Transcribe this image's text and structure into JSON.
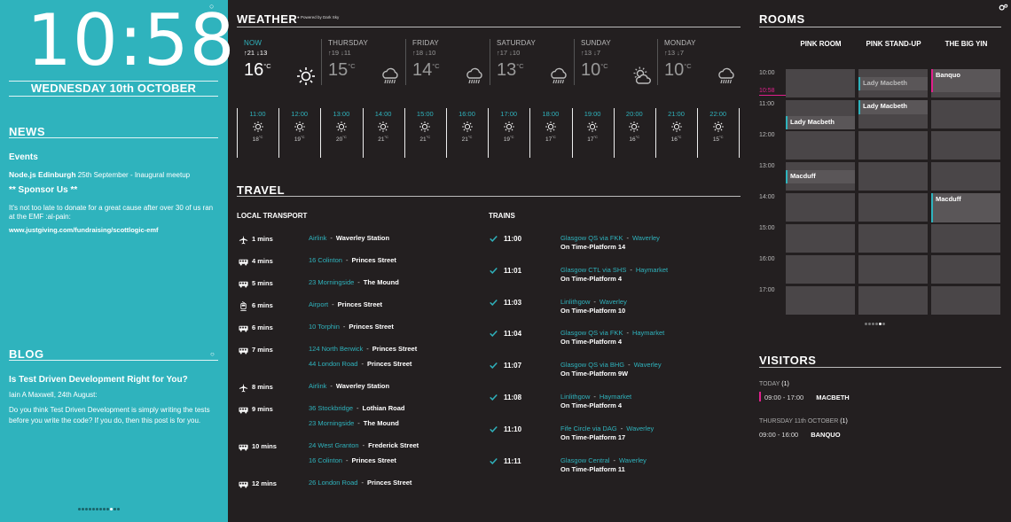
{
  "clock": {
    "time": "10:58",
    "date": "WEDNESDAY 10th OCTOBER"
  },
  "news": {
    "heading": "NEWS",
    "events_label": "Events",
    "event_name": "Node.js Edinburgh",
    "event_detail": "25th September - Inaugural meetup",
    "sponsor": "** Sponsor Us **",
    "body": "It's not too late to donate for a great cause after over 30 of us ran at the EMF :al-pain:",
    "link": "www.justgiving.com/fundraising/scottlogic-emf"
  },
  "blog": {
    "heading": "BLOG",
    "title": "Is Test Driven Development Right for You?",
    "author": "Iain A Maxwell, 24th August:",
    "body": "Do you think Test Driven Development is simply writing the tests before you write the code? If you do, then this post is for you."
  },
  "left_pager": {
    "count": 12,
    "active": 9
  },
  "weather": {
    "heading": "WEATHER",
    "powered": "Powered by Dark Sky",
    "days": [
      {
        "name": "NOW",
        "hilo": "↑21 ↓13",
        "temp": "16",
        "unit": "°C",
        "icon": "sun-icon"
      },
      {
        "name": "THURSDAY",
        "hilo": "↑19 ↓11",
        "temp": "15",
        "unit": "°C",
        "icon": "rain-icon"
      },
      {
        "name": "FRIDAY",
        "hilo": "↑18 ↓10",
        "temp": "14",
        "unit": "°C",
        "icon": "rain-icon"
      },
      {
        "name": "SATURDAY",
        "hilo": "↑17 ↓10",
        "temp": "13",
        "unit": "°C",
        "icon": "rain-icon"
      },
      {
        "name": "SUNDAY",
        "hilo": "↑13 ↓7",
        "temp": "10",
        "unit": "°C",
        "icon": "partly-cloudy-icon"
      },
      {
        "name": "MONDAY",
        "hilo": "↑13 ↓7",
        "temp": "10",
        "unit": "°C",
        "icon": "rain-icon"
      }
    ],
    "hours": [
      {
        "time": "11:00",
        "temp": "18",
        "unit": "°C"
      },
      {
        "time": "12:00",
        "temp": "19",
        "unit": "°C"
      },
      {
        "time": "13:00",
        "temp": "20",
        "unit": "°C"
      },
      {
        "time": "14:00",
        "temp": "21",
        "unit": "°C"
      },
      {
        "time": "15:00",
        "temp": "21",
        "unit": "°C"
      },
      {
        "time": "16:00",
        "temp": "21",
        "unit": "°C"
      },
      {
        "time": "17:00",
        "temp": "19",
        "unit": "°C"
      },
      {
        "time": "18:00",
        "temp": "17",
        "unit": "°C"
      },
      {
        "time": "19:00",
        "temp": "17",
        "unit": "°C"
      },
      {
        "time": "20:00",
        "temp": "16",
        "unit": "°C"
      },
      {
        "time": "21:00",
        "temp": "16",
        "unit": "°C"
      },
      {
        "time": "22:00",
        "temp": "15",
        "unit": "°C"
      }
    ]
  },
  "travel": {
    "heading": "TRAVEL",
    "local_heading": "LOCAL TRANSPORT",
    "trains_heading": "TRAINS",
    "local": [
      {
        "icon": "plane-icon",
        "mins": "1 mins",
        "lines": [
          {
            "route": "Airlink",
            "dest": "Waverley Station"
          }
        ]
      },
      {
        "icon": "bus-icon",
        "mins": "4 mins",
        "lines": [
          {
            "route": "16 Colinton",
            "dest": "Princes Street"
          }
        ]
      },
      {
        "icon": "bus-icon",
        "mins": "5 mins",
        "lines": [
          {
            "route": "23 Morningside",
            "dest": "The Mound"
          }
        ]
      },
      {
        "icon": "tram-icon",
        "mins": "6 mins",
        "lines": [
          {
            "route": "Airport",
            "dest": "Princes Street"
          }
        ]
      },
      {
        "icon": "bus-icon",
        "mins": "6 mins",
        "lines": [
          {
            "route": "10 Torphin",
            "dest": "Princes Street"
          }
        ]
      },
      {
        "icon": "bus-icon",
        "mins": "7 mins",
        "lines": [
          {
            "route": "124 North Berwick",
            "dest": "Princes Street"
          },
          {
            "route": "44 London Road",
            "dest": "Princes Street"
          }
        ]
      },
      {
        "icon": "plane-icon",
        "mins": "8 mins",
        "lines": [
          {
            "route": "Airlink",
            "dest": "Waverley Station"
          }
        ]
      },
      {
        "icon": "bus-icon",
        "mins": "9 mins",
        "lines": [
          {
            "route": "36 Stockbridge",
            "dest": "Lothian Road"
          },
          {
            "route": "23 Morningside",
            "dest": "The Mound"
          }
        ]
      },
      {
        "icon": "bus-icon",
        "mins": "10 mins",
        "lines": [
          {
            "route": "24 West Granton",
            "dest": "Frederick Street"
          },
          {
            "route": "16 Colinton",
            "dest": "Princes Street"
          }
        ]
      },
      {
        "icon": "bus-icon",
        "mins": "12 mins",
        "lines": [
          {
            "route": "26 London Road",
            "dest": "Princes Street"
          }
        ]
      }
    ],
    "trains": [
      {
        "time": "11:00",
        "from": "Glasgow QS via FKK",
        "to": "Waverley",
        "status": "On Time",
        "platform": "Platform 14"
      },
      {
        "time": "11:01",
        "from": "Glasgow CTL via SHS",
        "to": "Haymarket",
        "status": "On Time",
        "platform": "Platform 4"
      },
      {
        "time": "11:03",
        "from": "Linlithgow",
        "to": "Waverley",
        "status": "On Time",
        "platform": "Platform 10"
      },
      {
        "time": "11:04",
        "from": "Glasgow QS via FKK",
        "to": "Haymarket",
        "status": "On Time",
        "platform": "Platform 4"
      },
      {
        "time": "11:07",
        "from": "Glasgow QS via BHG",
        "to": "Waverley",
        "status": "On Time",
        "platform": "Platform 9W"
      },
      {
        "time": "11:08",
        "from": "Linlithgow",
        "to": "Haymarket",
        "status": "On Time",
        "platform": "Platform 4"
      },
      {
        "time": "11:10",
        "from": "Fife Circle via DAG",
        "to": "Waverley",
        "status": "On Time",
        "platform": "Platform 17"
      },
      {
        "time": "11:11",
        "from": "Glasgow Central",
        "to": "Waverley",
        "status": "On Time",
        "platform": "Platform 11"
      }
    ]
  },
  "rooms": {
    "heading": "ROOMS",
    "names": [
      "PINK ROOM",
      "PINK STAND-UP",
      "THE BIG YIN"
    ],
    "hours": [
      "10:00",
      "11:00",
      "12:00",
      "13:00",
      "14:00",
      "15:00",
      "16:00",
      "17:00"
    ],
    "now": "10:58",
    "bookings": [
      {
        "room": 1,
        "start": 10.25,
        "end": 10.75,
        "name": "Lady Macbeth",
        "past": true
      },
      {
        "room": 1,
        "start": 11.0,
        "end": 11.5,
        "name": "Lady Macbeth",
        "past": false
      },
      {
        "room": 0,
        "start": 11.5,
        "end": 12.0,
        "name": "Lady Macbeth",
        "past": false
      },
      {
        "room": 2,
        "start": 10.0,
        "end": 10.8,
        "name": "Banquo",
        "past": false
      },
      {
        "room": 0,
        "start": 13.25,
        "end": 13.75,
        "name": "Macduff",
        "past": false
      },
      {
        "room": 2,
        "start": 14.0,
        "end": 15.0,
        "name": "Macduff",
        "past": false
      }
    ],
    "pager": {
      "count": 6,
      "active": 4
    }
  },
  "visitors": {
    "heading": "VISITORS",
    "groups": [
      {
        "day": "TODAY",
        "count": "(1)",
        "time": "09:00 - 17:00",
        "name": "MACBETH",
        "bar": true
      },
      {
        "day": "THURSDAY 11th OCTOBER",
        "count": "(1)",
        "time": "09:00 - 16:00",
        "name": "BANQUO",
        "bar": false
      }
    ]
  },
  "colors": {
    "teal": "#2fb3bd",
    "pink": "#e0208c",
    "background": "#231f20"
  }
}
